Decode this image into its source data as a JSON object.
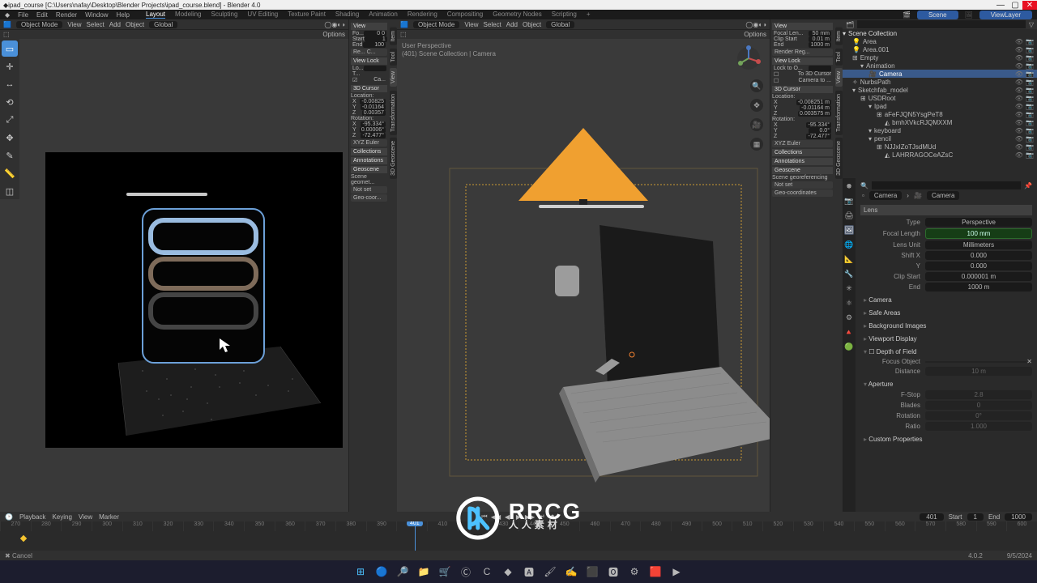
{
  "window": {
    "title": "ipad_course [C:\\Users\\nafay\\Desktop\\Blender Projects\\ipad_course.blend] - Blender 4.0",
    "min_icon": "—",
    "max_icon": "▢",
    "close_icon": "✕"
  },
  "top_menu": {
    "blender_icon": "◆",
    "items": [
      "File",
      "Edit",
      "Render",
      "Window",
      "Help"
    ],
    "workspaces": [
      "Layout",
      "Modeling",
      "Sculpting",
      "UV Editing",
      "Texture Paint",
      "Shading",
      "Animation",
      "Rendering",
      "Compositing",
      "Geometry Nodes",
      "Scripting"
    ],
    "active_workspace": 0,
    "add_ws": "+",
    "scene_label": "Scene",
    "viewlayer_label": "ViewLayer"
  },
  "left_viewport": {
    "mode": "Object Mode",
    "menus": [
      "View",
      "Select",
      "Add",
      "Object"
    ],
    "orientation": "Global",
    "overlay_row": {
      "snap_icon": "◧",
      "pivot_icon": "⊙",
      "options": "Options"
    },
    "tools": [
      "▭",
      "↔",
      "⟲",
      "⤢",
      "✥",
      "✎",
      "◫"
    ],
    "active_tool": 0,
    "info_bump": "",
    "n_panel": {
      "tabs": [
        "Item",
        "Tool",
        "View",
        "Transformation",
        "3D Geoscene"
      ],
      "active_tab": 2,
      "view": {
        "label": "View",
        "focal_label": "Fo...",
        "focal_value": "0 0",
        "start_label": "Start",
        "start_value": "1",
        "end_label": "End",
        "end_value": "100"
      },
      "resolution": {
        "icon": "Re...",
        "c_btn": "C..."
      },
      "view_lock": {
        "label": "View Lock",
        "lock_to": "Lo...",
        "to": "T...",
        "ca_checkbox": "Ca..."
      },
      "cursor3d": {
        "label": "3D Cursor",
        "loc_label": "Location:",
        "x": "-0.00825",
        "y": "-0.01164",
        "z": "0.00357",
        "rot_label": "Rotation:",
        "rx": "-95.334°",
        "ry": "0.00006°",
        "rz": "-72.477°",
        "euler": "XYZ Euler"
      },
      "sections": [
        "Collections",
        "Annotations",
        "Geoscene"
      ],
      "scene_geo": {
        "label": "Scene geomet...",
        "notset": "Not set",
        "copy_btn": "▭",
        "geo_btn": "Geo-coor..."
      }
    }
  },
  "right_viewport": {
    "mode": "Object Mode",
    "menus": [
      "View",
      "Select",
      "Add",
      "Object"
    ],
    "orientation": "Global",
    "overlay_row": {
      "options": "Options"
    },
    "info1": "User Perspective",
    "info2": "(401) Scene Collection | Camera",
    "gizmo_icons": {
      "zoom": "🔍",
      "move": "✥",
      "cam": "🎥",
      "persp": "▦"
    },
    "n_panel": {
      "tabs": [
        "Item",
        "Tool",
        "View",
        "Transformation",
        "3D Geoscene"
      ],
      "active_tab": 2,
      "view": {
        "label": "View",
        "focal_label": "Focal Len...",
        "focal_value": "50 mm",
        "start_label": "Clip Start",
        "start_value": "0.01 m",
        "end_label": "End",
        "end_value": "1000 m"
      },
      "render_reg": "Render Reg...",
      "view_lock": {
        "label": "View Lock",
        "lock_to": "Lock to O...",
        "to_3d": "To 3D Cursor",
        "cam_to": "Camera to ..."
      },
      "cursor3d": {
        "label": "3D Cursor",
        "loc_label": "Location:",
        "x": "-0.008251 m",
        "y": "-0.01164 m",
        "z": "0.003575 m",
        "rot_label": "Rotation:",
        "rx": "-95.334°",
        "ry": "0.0°",
        "rz": "-72.477°",
        "euler": "XYZ Euler"
      },
      "sections": [
        "Collections",
        "Annotations",
        "Geoscene"
      ],
      "scene_geo": {
        "label": "Scene georeferencing",
        "notset": "Not set",
        "geo": "Geo-coordinates"
      }
    }
  },
  "outliner": {
    "filter_placeholder": "",
    "items": [
      {
        "depth": 0,
        "icon": "▾",
        "label": "Scene Collection",
        "selected": false,
        "right": [
          "",
          ""
        ]
      },
      {
        "depth": 1,
        "icon": "💡",
        "label": "Area",
        "selected": false,
        "right": [
          "👁",
          "📷"
        ]
      },
      {
        "depth": 1,
        "icon": "💡",
        "label": "Area.001",
        "selected": false,
        "right": [
          "👁",
          "📷"
        ]
      },
      {
        "depth": 1,
        "icon": "⊞",
        "label": "Empty",
        "selected": false,
        "right": [
          "👁",
          "📷"
        ]
      },
      {
        "depth": 2,
        "icon": "▾",
        "label": "Animation",
        "badge": "①",
        "selected": false,
        "right": [
          "👁",
          "📷"
        ]
      },
      {
        "depth": 3,
        "icon": "🎥",
        "label": "Camera",
        "selected": true,
        "right": [
          "👁",
          "📷"
        ]
      },
      {
        "depth": 1,
        "icon": "✧",
        "label": "NurbsPath",
        "selected": false,
        "right": [
          "👁",
          "📷"
        ]
      },
      {
        "depth": 1,
        "icon": "▾",
        "label": "Sketchfab_model",
        "selected": false,
        "right": [
          "👁",
          "📷"
        ]
      },
      {
        "depth": 2,
        "icon": "⊞",
        "label": "USDRoot",
        "selected": false,
        "right": [
          "👁",
          "📷"
        ]
      },
      {
        "depth": 3,
        "icon": "▾",
        "label": "Ipad",
        "selected": false,
        "right": [
          "👁",
          "📷"
        ]
      },
      {
        "depth": 4,
        "icon": "⊞",
        "label": "aFeFJQN5YsgPeT8",
        "selected": false,
        "right": [
          "👁",
          "📷"
        ]
      },
      {
        "depth": 5,
        "icon": "◭",
        "label": "bmhXVkcRJQMXXM",
        "selected": false,
        "right": [
          "👁",
          "📷"
        ]
      },
      {
        "depth": 3,
        "icon": "▾",
        "label": "keyboard",
        "selected": false,
        "right": [
          "👁",
          "📷"
        ]
      },
      {
        "depth": 3,
        "icon": "▾",
        "label": "pencil",
        "selected": false,
        "right": [
          "👁",
          "📷"
        ]
      },
      {
        "depth": 4,
        "icon": "⊞",
        "label": "NJJxIZoTJsdMUd",
        "selected": false,
        "right": [
          "👁",
          "📷"
        ]
      },
      {
        "depth": 5,
        "icon": "◭",
        "label": "LAHRRAGOCeAZsC",
        "selected": false,
        "right": [
          "👁",
          "📷"
        ]
      }
    ]
  },
  "properties": {
    "search_placeholder": "",
    "tabs": [
      "🞿",
      "📷",
      "🖨",
      "🖼",
      "🌐",
      "📐",
      "🔧",
      "✳",
      "⚛",
      "⚙",
      "🔺",
      "🟢"
    ],
    "active_tab": 3,
    "breadcrumb": {
      "obj_icon": "▫",
      "obj": "Camera",
      "data_icon": "🎥",
      "data": "Camera"
    },
    "pin_icon": "📌",
    "lens": {
      "header": "Lens",
      "type_label": "Type",
      "type_value": "Perspective",
      "focal_label": "Focal Length",
      "focal_value": "100 mm",
      "lens_unit_label": "Lens Unit",
      "lens_unit_value": "Millimeters",
      "shift_x_label": "Shift X",
      "shift_x_value": "0.000",
      "shift_y_label": "Y",
      "shift_y_value": "0.000",
      "clip_start_label": "Clip Start",
      "clip_start_value": "0.000001 m",
      "clip_end_label": "End",
      "clip_end_value": "1000 m"
    },
    "sections": [
      "Camera",
      "Safe Areas",
      "Background Images",
      "Viewport Display"
    ],
    "dof": {
      "header": "Depth of Field",
      "focus_obj_label": "Focus Object",
      "focus_obj_value": "",
      "focus_obj_icon": "✕",
      "distance_label": "Distance",
      "distance_value": "10 m"
    },
    "aperture": {
      "header": "Aperture",
      "fstop_label": "F-Stop",
      "fstop_value": "2.8",
      "blades_label": "Blades",
      "blades_value": "0",
      "rotation_label": "Rotation",
      "rotation_value": "0°",
      "ratio_label": "Ratio",
      "ratio_value": "1.000"
    },
    "custom_props": "Custom Properties"
  },
  "timeline": {
    "menus": [
      "Playback",
      "Keying",
      "View",
      "Marker"
    ],
    "play_icons": [
      "⏮",
      "◀◀",
      "◀",
      "▶",
      "▶▶",
      "⏭",
      "⏺"
    ],
    "current_frame_label": "",
    "current_frame": "401",
    "start_label": "Start",
    "start": "1",
    "end_label": "End",
    "end": "1000",
    "ticks": [
      "270",
      "280",
      "290",
      "300",
      "310",
      "320",
      "330",
      "340",
      "350",
      "360",
      "370",
      "380",
      "390",
      "400",
      "410",
      "420",
      "430",
      "440",
      "450",
      "460",
      "470",
      "480",
      "490",
      "500",
      "510",
      "520",
      "530",
      "540",
      "550",
      "560",
      "570",
      "580",
      "590",
      "600"
    ]
  },
  "status": {
    "left_icon": "✖",
    "cancel": "Cancel",
    "right_version": "4.0.2",
    "date": "9/5/2024"
  },
  "taskbar_icons": [
    "⊞",
    "🔵",
    "🔎",
    "📁",
    "🛒",
    "Ⓒ",
    "C",
    "◆",
    "🅰",
    "🖌",
    "✍",
    "⬛",
    "🅾",
    "⚙",
    "🟥",
    "▶"
  ],
  "watermark": {
    "main": "RRCG",
    "sub": "人人素材"
  },
  "colors": {
    "accent_blue": "#4a90d9",
    "keyframe_green": "#2d6a2d",
    "axis_x": "#c54c4c",
    "axis_y": "#73a35a",
    "axis_z": "#4b78c1",
    "camera_tri": "#f0a030"
  }
}
